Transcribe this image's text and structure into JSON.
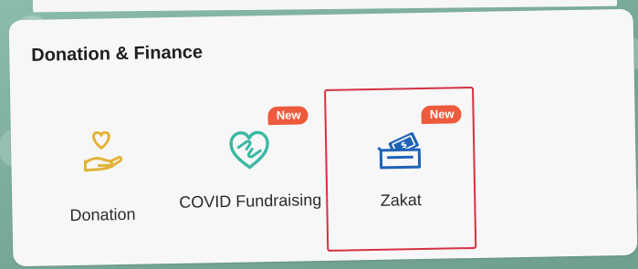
{
  "section": {
    "title": "Donation & Finance"
  },
  "tiles": [
    {
      "label": "Donation",
      "icon": "hand-heart-icon",
      "color": "#e2b33a"
    },
    {
      "label": "COVID Fundraising",
      "badge": "New",
      "icon": "heart-hands-icon",
      "color": "#3bb8a2"
    },
    {
      "label": "Zakat",
      "badge": "New",
      "icon": "cash-envelope-icon",
      "color": "#1f63b7",
      "highlighted": true,
      "highlight_color": "#d4313f"
    }
  ],
  "colors": {
    "badge": "#ee5a3e",
    "card": "#f7f7f7",
    "background": "#7fb0a2"
  }
}
